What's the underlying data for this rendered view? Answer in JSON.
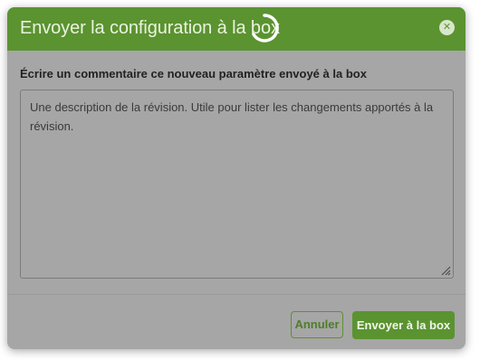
{
  "modal": {
    "title": "Envoyer la configuration à la box",
    "close_icon": "close-icon",
    "loading_icon": "spinner-icon"
  },
  "form": {
    "label": "Écrire un commentaire ce nouveau paramètre envoyé à la box",
    "textarea_placeholder": "Une description de la révision. Utile pour lister les changements apportés à la révision.",
    "textarea_value": ""
  },
  "footer": {
    "cancel_label": "Annuler",
    "submit_label": "Envoyer à la box"
  },
  "colors": {
    "accent": "#5b9330",
    "overlay": "#a6a6a6"
  }
}
